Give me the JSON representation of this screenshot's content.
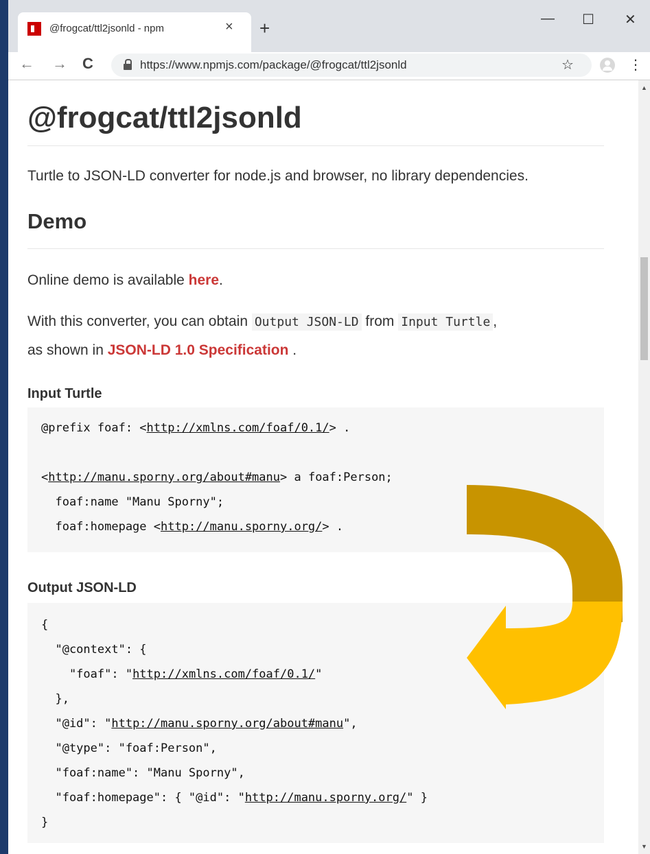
{
  "browser": {
    "tab_title": "@frogcat/ttl2jsonld - npm",
    "tab_close": "×",
    "new_tab": "+",
    "minimize": "—",
    "maximize": "☐",
    "close": "✕",
    "back": "←",
    "forward": "→",
    "reload": "C",
    "url": "https://www.npmjs.com/package/@frogcat/ttl2jsonld",
    "bookmark": "☆",
    "menu": "⋮"
  },
  "page": {
    "title": "@frogcat/ttl2jsonld",
    "description": "Turtle to JSON-LD converter for node.js and browser, no library dependencies.",
    "demo_heading": "Demo",
    "demo_text_before": "Online demo is available ",
    "demo_link": "here",
    "demo_text_after": ".",
    "conv_text_1": "With this converter, you can obtain ",
    "conv_code_1": "Output JSON-LD",
    "conv_text_2": " from ",
    "conv_code_2": "Input Turtle",
    "conv_text_3": ",",
    "spec_before": "as shown in ",
    "spec_link": "JSON-LD 1.0 Specification",
    "spec_after": " .",
    "input_heading": "Input Turtle",
    "output_heading": "Output JSON-LD",
    "turtle": [
      {
        "parts": [
          {
            "t": "@prefix foaf: <"
          },
          {
            "t": "http://xmlns.com/foaf/0.1/",
            "u": true
          },
          {
            "t": "> ."
          }
        ]
      },
      {
        "parts": [
          {
            "t": ""
          }
        ]
      },
      {
        "parts": [
          {
            "t": "<"
          },
          {
            "t": "http://manu.sporny.org/about#manu",
            "u": true
          },
          {
            "t": "> a foaf:Person;"
          }
        ]
      },
      {
        "parts": [
          {
            "t": "  foaf:name \"Manu Sporny\";"
          }
        ]
      },
      {
        "parts": [
          {
            "t": "  foaf:homepage <"
          },
          {
            "t": "http://manu.sporny.org/",
            "u": true
          },
          {
            "t": "> ."
          }
        ]
      }
    ],
    "jsonld": [
      {
        "parts": [
          {
            "t": "{"
          }
        ]
      },
      {
        "parts": [
          {
            "t": "  \"@context\": {"
          }
        ]
      },
      {
        "parts": [
          {
            "t": "    \"foaf\": \""
          },
          {
            "t": "http://xmlns.com/foaf/0.1/",
            "u": true
          },
          {
            "t": "\""
          }
        ]
      },
      {
        "parts": [
          {
            "t": "  },"
          }
        ]
      },
      {
        "parts": [
          {
            "t": "  \"@id\": \""
          },
          {
            "t": "http://manu.sporny.org/about#manu",
            "u": true
          },
          {
            "t": "\","
          }
        ]
      },
      {
        "parts": [
          {
            "t": "  \"@type\": \"foaf:Person\","
          }
        ]
      },
      {
        "parts": [
          {
            "t": "  \"foaf:name\": \"Manu Sporny\","
          }
        ]
      },
      {
        "parts": [
          {
            "t": "  \"foaf:homepage\": { \"@id\": \""
          },
          {
            "t": "http://manu.sporny.org/",
            "u": true
          },
          {
            "t": "\" }"
          }
        ]
      },
      {
        "parts": [
          {
            "t": "}"
          }
        ]
      }
    ]
  },
  "colors": {
    "accent": "#cb3837",
    "arrow_dark": "#c89400",
    "arrow_light": "#ffc000"
  }
}
